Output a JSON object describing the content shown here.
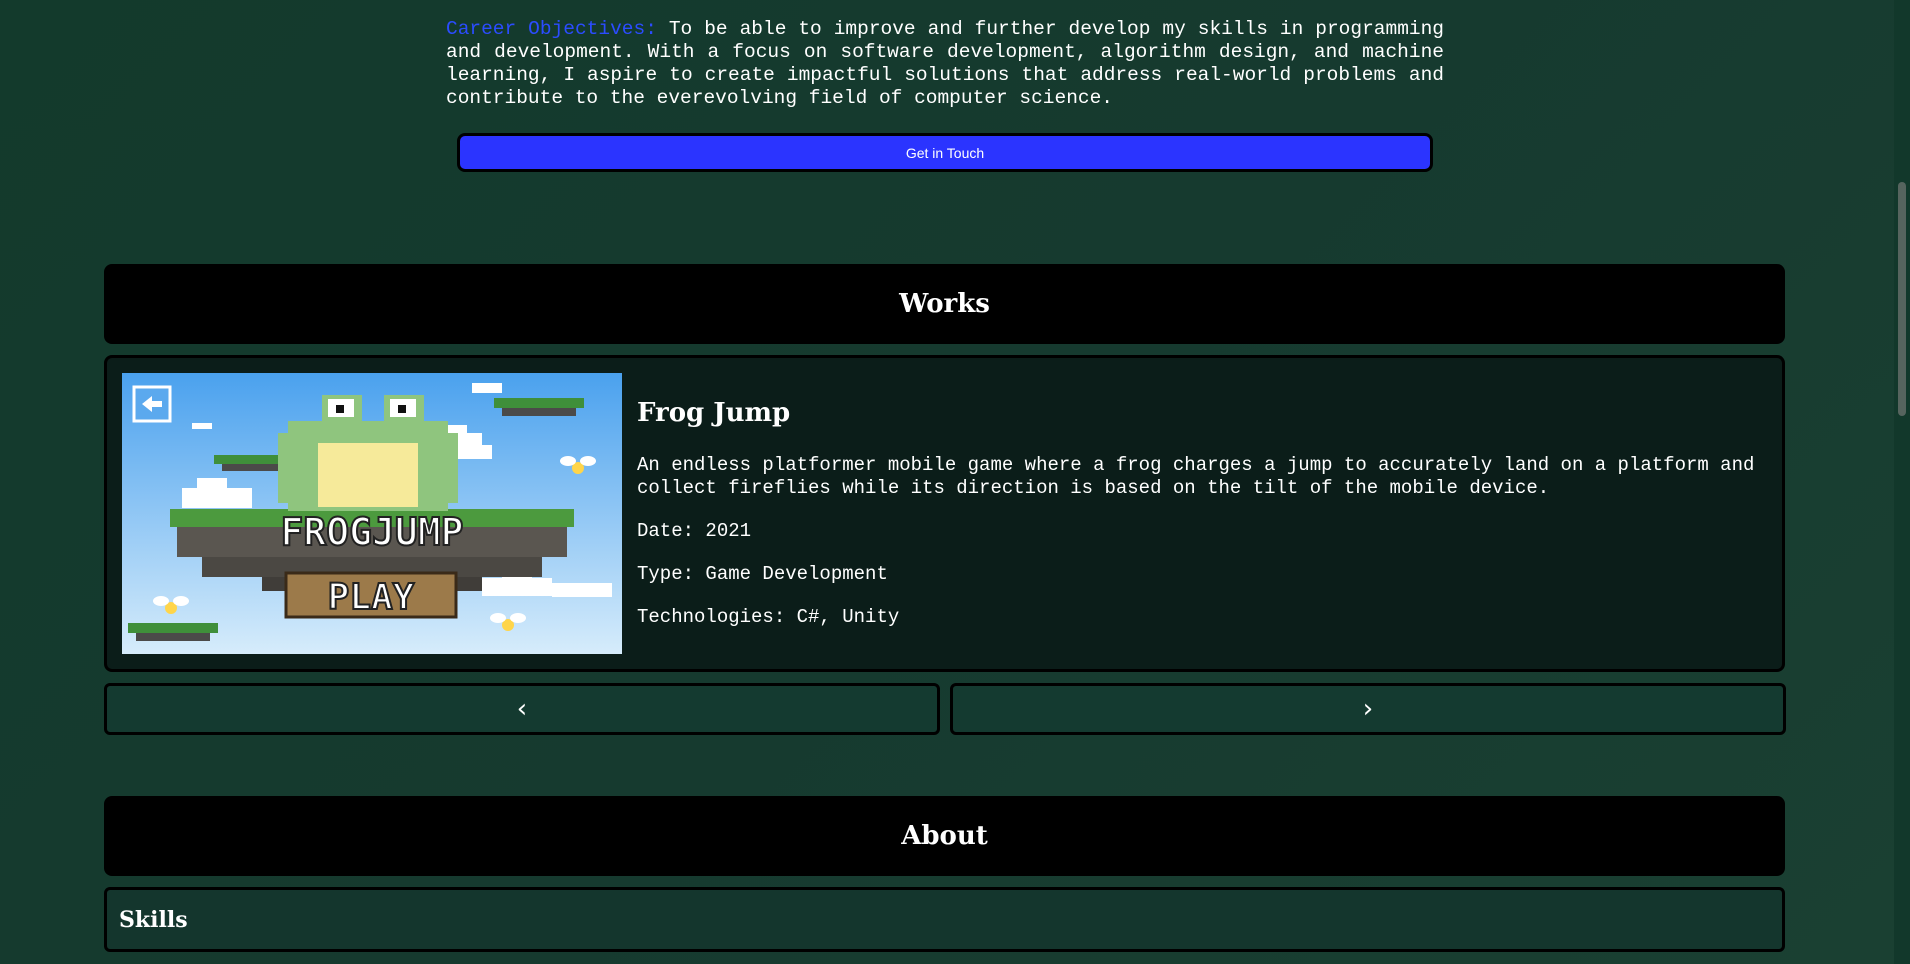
{
  "objectives": {
    "label": "Career Objectives:",
    "text": "To be able to improve and further develop my skills in programming and development. With a focus on software development, algorithm design, and machine learning, I aspire to create impactful solutions that address real-world problems and contribute to the everevolving field of computer science."
  },
  "contact": {
    "button_label": "Get in Touch"
  },
  "works": {
    "heading": "Works",
    "item": {
      "title": "Frog Jump",
      "description": "An endless platformer mobile game where a frog charges a jump to accurately land on a platform and collect fireflies while its direction is based on the tilt of the mobile device.",
      "date": "Date: 2021",
      "type": "Type: Game Development",
      "technologies": "Technologies: C#, Unity",
      "image": {
        "logo_text": "FROGJUMP",
        "play_text": "PLAY"
      }
    },
    "prev_label": "‹",
    "next_label": "›"
  },
  "about": {
    "heading": "About",
    "skills_label": "Skills"
  },
  "colors": {
    "accent": "#2b34ff",
    "label_blue": "#2b4cff",
    "background": "#163a2f"
  }
}
